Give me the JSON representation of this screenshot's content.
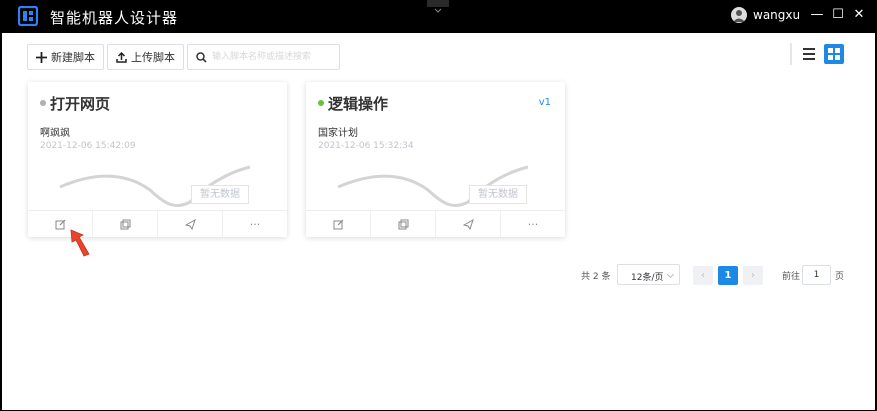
{
  "app": {
    "title": "智能机器人设计器",
    "user": "wangxu"
  },
  "window_controls": {
    "minimize": "—",
    "maximize": "☐",
    "close": "✕"
  },
  "toolbar": {
    "new_script_label": "新建脚本",
    "upload_script_label": "上传脚本",
    "search_placeholder": "输入脚本名称或描述搜索"
  },
  "cards": [
    {
      "title": "打开网页",
      "status_color": "#b0b0b0",
      "version": "",
      "description": "啊飒飒",
      "date": "2021-12-06 15:42:09",
      "no_data": "暂无数据",
      "actions": [
        "edit-icon",
        "copy-icon",
        "send-icon",
        "more-icon"
      ],
      "more_label": "···"
    },
    {
      "title": "逻辑操作",
      "status_color": "#67c23a",
      "version": "v1",
      "description": "国家计划",
      "date": "2021-12-06 15:32:34",
      "no_data": "暂无数据",
      "actions": [
        "edit-icon",
        "copy-icon",
        "send-icon",
        "more-icon"
      ],
      "more_label": "···"
    }
  ],
  "pagination": {
    "total": "共 2 条",
    "page_size": "12条/页",
    "prev": "‹",
    "current": "1",
    "next": "›",
    "goto_label": "前往",
    "goto_value": "1",
    "page_suffix": "页"
  },
  "colors": {
    "accent": "#1e88e5",
    "status_inactive": "#b0b0b0",
    "status_active": "#67c23a"
  }
}
